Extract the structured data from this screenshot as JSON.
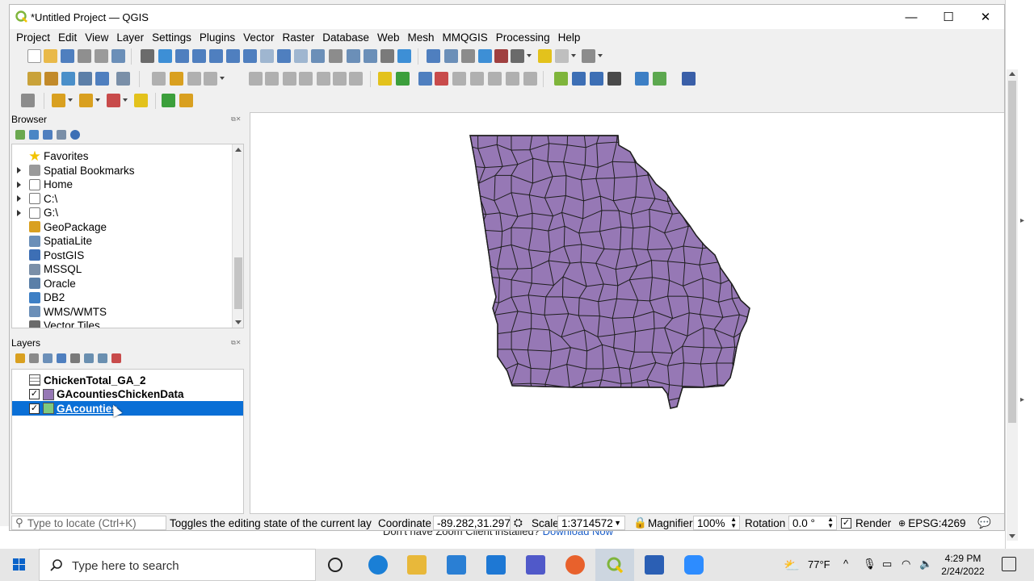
{
  "window": {
    "title": "*Untitled Project — QGIS",
    "minimize": "—",
    "maximize": "☐",
    "close": "✕"
  },
  "menubar": {
    "items": [
      "Project",
      "Edit",
      "View",
      "Layer",
      "Settings",
      "Plugins",
      "Vector",
      "Raster",
      "Database",
      "Web",
      "Mesh",
      "MMQGIS",
      "Processing",
      "Help"
    ]
  },
  "browser": {
    "title": "Browser",
    "items": [
      {
        "label": "Favorites",
        "icon": "star-icon",
        "expandable": false
      },
      {
        "label": "Spatial Bookmarks",
        "icon": "bookmark-icon",
        "expandable": true
      },
      {
        "label": "Home",
        "icon": "home-folder-icon",
        "expandable": true
      },
      {
        "label": "C:\\",
        "icon": "drive-icon",
        "expandable": true
      },
      {
        "label": "G:\\",
        "icon": "drive-icon",
        "expandable": true
      },
      {
        "label": "GeoPackage",
        "icon": "geopackage-icon",
        "expandable": false
      },
      {
        "label": "SpatiaLite",
        "icon": "spatialite-icon",
        "expandable": false
      },
      {
        "label": "PostGIS",
        "icon": "postgis-icon",
        "expandable": false
      },
      {
        "label": "MSSQL",
        "icon": "mssql-icon",
        "expandable": false
      },
      {
        "label": "Oracle",
        "icon": "oracle-icon",
        "expandable": false
      },
      {
        "label": "DB2",
        "icon": "db2-icon",
        "expandable": false
      },
      {
        "label": "WMS/WMTS",
        "icon": "wms-icon",
        "expandable": false
      },
      {
        "label": "Vector Tiles",
        "icon": "vector-tiles-icon",
        "expandable": false
      }
    ]
  },
  "layers": {
    "title": "Layers",
    "items": [
      {
        "label": "ChickenTotal_GA_2",
        "checked": false,
        "type": "table",
        "selected": false
      },
      {
        "label": "GAcountiesChickenData",
        "checked": true,
        "type": "polygon",
        "color": "#9678b5",
        "selected": false
      },
      {
        "label": "GAcounties",
        "checked": true,
        "type": "polygon",
        "color": "#7fc97f",
        "selected": true
      }
    ]
  },
  "statusbar": {
    "locate_placeholder": "Type to locate (Ctrl+K)",
    "message": "Toggles the editing state of the current lay",
    "coordinate_label": "Coordinate",
    "coordinate_value": "-89.282,31.297",
    "scale_label": "Scale",
    "scale_value": "1:3714572",
    "magnifier_label": "Magnifier",
    "magnifier_value": "100%",
    "rotation_label": "Rotation",
    "rotation_value": "0.0 °",
    "render_label": "Render",
    "crs": "EPSG:4269"
  },
  "background": {
    "zoom_text": "Don't have Zoom Client installed?",
    "zoom_link": "Download Now"
  },
  "taskbar": {
    "search_placeholder": "Type here to search",
    "weather": "77°F",
    "time": "4:29 PM",
    "date": "2/24/2022"
  },
  "colors": {
    "map_fill": "#9678b5",
    "map_stroke": "#1e1e1e",
    "selection": "#0a6fd6"
  }
}
